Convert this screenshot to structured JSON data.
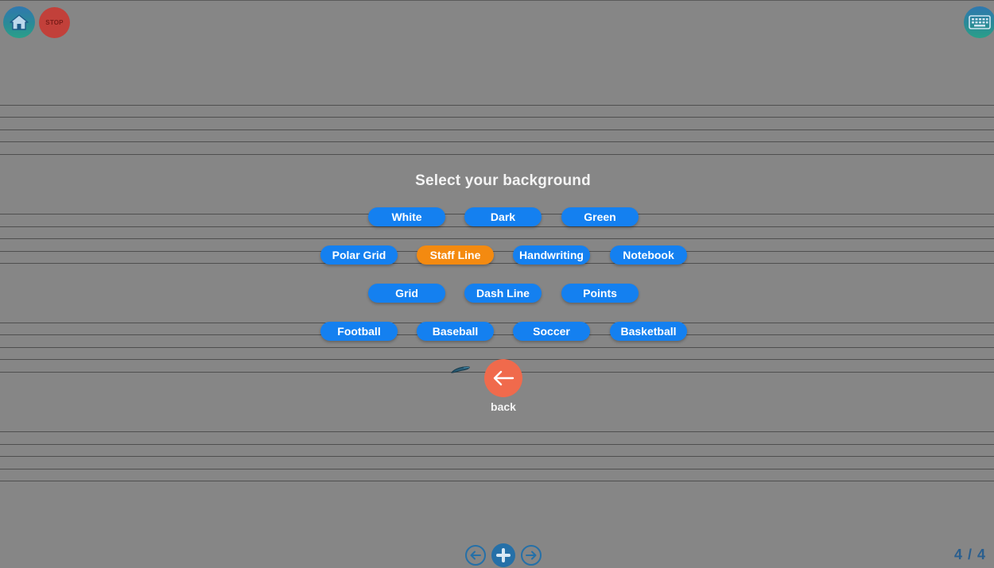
{
  "toolbar": {
    "home_icon": "home-icon",
    "stop_label": "STOP",
    "keyboard_icon": "keyboard-icon"
  },
  "dialog": {
    "title": "Select your background",
    "options": [
      {
        "label": "White",
        "selected": false
      },
      {
        "label": "Dark",
        "selected": false
      },
      {
        "label": "Green",
        "selected": false
      },
      {
        "label": "Polar Grid",
        "selected": false
      },
      {
        "label": "Staff Line",
        "selected": true
      },
      {
        "label": "Handwriting",
        "selected": false
      },
      {
        "label": "Notebook",
        "selected": false
      },
      {
        "label": "Grid",
        "selected": false
      },
      {
        "label": "Dash Line",
        "selected": false
      },
      {
        "label": "Points",
        "selected": false
      },
      {
        "label": "Football",
        "selected": false
      },
      {
        "label": "Baseball",
        "selected": false
      },
      {
        "label": "Soccer",
        "selected": false
      },
      {
        "label": "Basketball",
        "selected": false
      }
    ],
    "back_label": "back"
  },
  "footer": {
    "page_counter": "4 / 4"
  },
  "colors": {
    "button_blue": "#1480f0",
    "button_selected": "#f48a10",
    "back_button": "#f06a4c",
    "background": "#868686"
  }
}
